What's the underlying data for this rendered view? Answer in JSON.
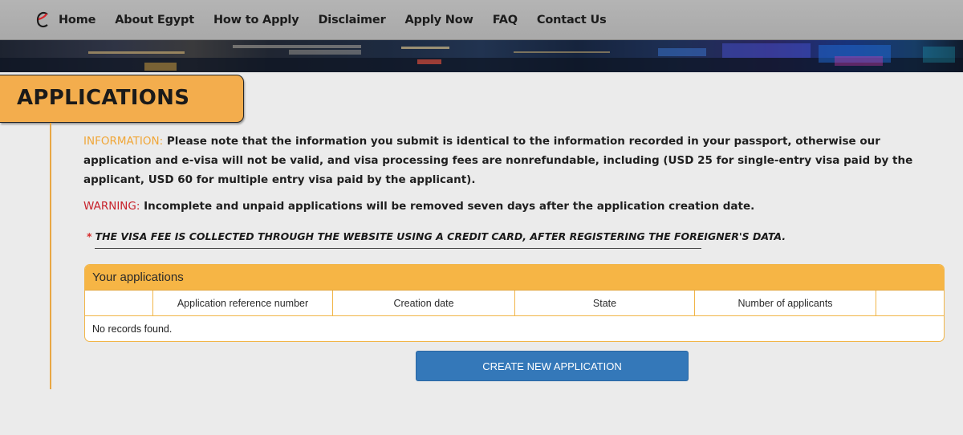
{
  "nav": {
    "logo_icon": "e-logo-icon",
    "items": [
      "Home",
      "About Egypt",
      "How to Apply",
      "Disclaimer",
      "Apply Now",
      "FAQ",
      "Contact Us"
    ]
  },
  "page": {
    "title": "APPLICATIONS"
  },
  "info": {
    "label": "INFORMATION:",
    "text": " Please note that the information you submit is identical to the information recorded in your passport, otherwise our application and e-visa will not be valid, and visa processing fees are nonrefundable, including (USD 25 for single-entry visa paid by the applicant, USD 60 for multiple entry visa paid by the applicant)."
  },
  "warning": {
    "label": "WARNING:",
    "text": " Incomplete and unpaid applications will be removed seven days after the application creation date."
  },
  "notice": {
    "star": "*",
    "text": "THE VISA FEE IS COLLECTED THROUGH THE WEBSITE USING A CREDIT CARD, AFTER REGISTERING THE FOREIGNER'S DATA."
  },
  "applications": {
    "title": "Your applications",
    "columns": [
      "",
      "Application reference number",
      "Creation date",
      "State",
      "Number of applicants",
      ""
    ],
    "empty_message": "No records found."
  },
  "actions": {
    "create_label": "CREATE NEW APPLICATION"
  },
  "colors": {
    "accent_orange": "#f3ad4d",
    "info_label": "#f0a637",
    "warning_label": "#c8232c",
    "primary_button": "#3478b9"
  }
}
